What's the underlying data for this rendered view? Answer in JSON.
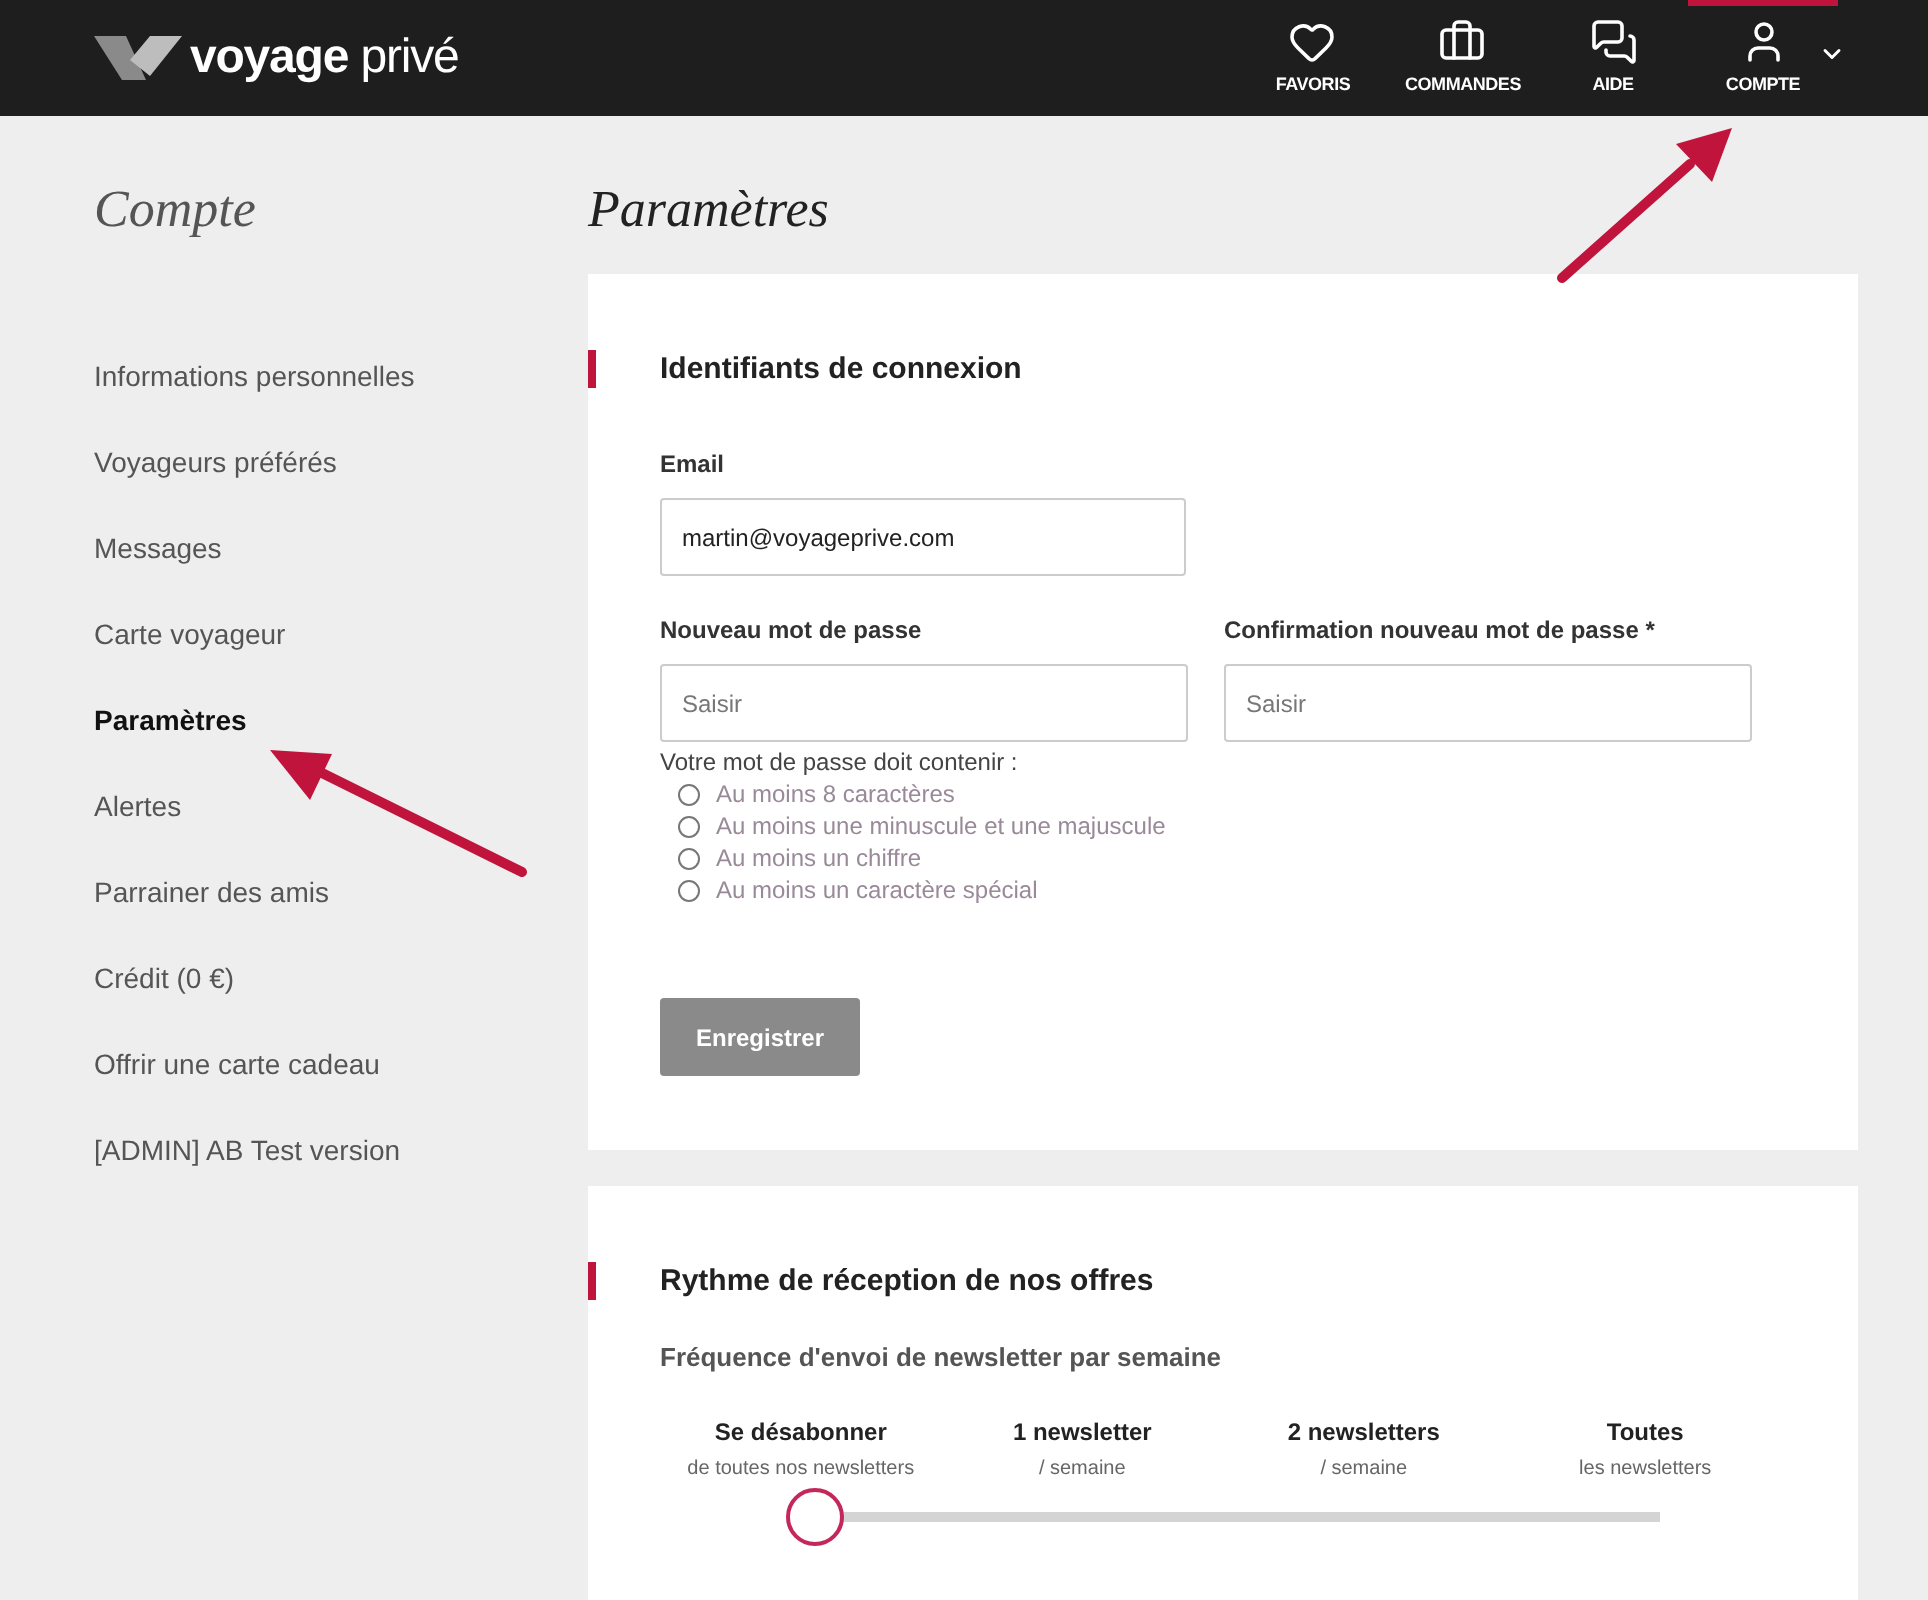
{
  "header": {
    "logo": {
      "word1": "voyage",
      "word2": "privé"
    },
    "nav": [
      {
        "kind": "heart",
        "label": "FAVORIS",
        "selected": false
      },
      {
        "kind": "briefcase",
        "label": "COMMANDES",
        "selected": false
      },
      {
        "kind": "chat",
        "label": "AIDE",
        "selected": false
      },
      {
        "kind": "user",
        "label": "COMPTE",
        "selected": true,
        "dropdown": true
      }
    ]
  },
  "sidebar": {
    "title": "Compte",
    "items": [
      {
        "label": "Informations personnelles",
        "selected": false
      },
      {
        "label": "Voyageurs préférés",
        "selected": false
      },
      {
        "label": "Messages",
        "selected": false
      },
      {
        "label": "Carte voyageur",
        "selected": false
      },
      {
        "label": "Paramètres",
        "selected": true
      },
      {
        "label": "Alertes",
        "selected": false
      },
      {
        "label": "Parrainer des amis",
        "selected": false
      },
      {
        "label": "Crédit (0 €)",
        "selected": false
      },
      {
        "label": "Offrir une carte cadeau",
        "selected": false
      },
      {
        "label": "[ADMIN] AB Test version",
        "selected": false
      }
    ]
  },
  "page_title": "Paramètres",
  "login_card": {
    "heading": "Identifiants de connexion",
    "email": {
      "label": "Email",
      "value": "martin@voyageprive.com"
    },
    "password_fields": [
      {
        "label": "Nouveau mot de passe",
        "placeholder": "Saisir"
      },
      {
        "label": "Confirmation nouveau mot de passe *",
        "placeholder": "Saisir"
      }
    ],
    "rules_title": "Votre mot de passe doit contenir :",
    "rules": [
      {
        "label": "Au moins 8 caractères",
        "checked": false
      },
      {
        "label": "Au moins une minuscule et une majuscule",
        "checked": false
      },
      {
        "label": "Au moins un chiffre",
        "checked": false
      },
      {
        "label": "Au moins un caractère spécial",
        "checked": false
      }
    ],
    "save_button": "Enregistrer"
  },
  "newsletter_card": {
    "heading": "Rythme de réception de nos offres",
    "subheading": "Fréquence d'envoi de newsletter par semaine",
    "options": [
      {
        "title": "Se désabonner",
        "subtitle": "de toutes nos newsletters"
      },
      {
        "title": "1 newsletter",
        "subtitle": "/ semaine"
      },
      {
        "title": "2 newsletters",
        "subtitle": "/ semaine"
      },
      {
        "title": "Toutes",
        "subtitle": "les newsletters"
      }
    ],
    "slider": {
      "level": 0
    }
  }
}
